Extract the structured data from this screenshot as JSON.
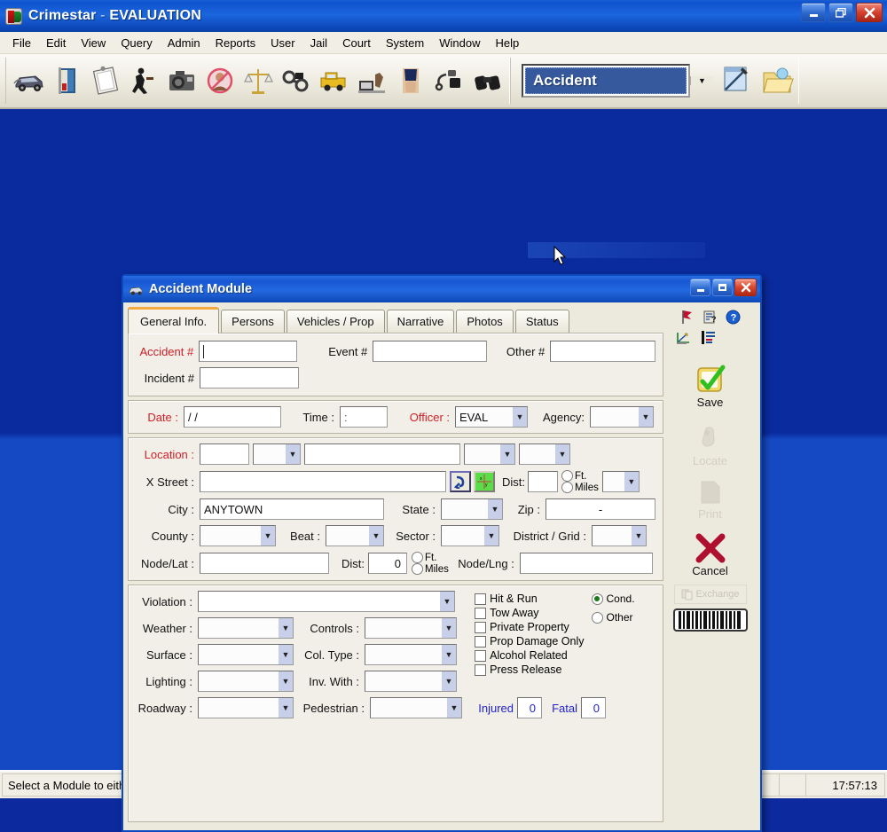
{
  "app": {
    "title_main": "Crimestar",
    "title_sep": " - ",
    "title_sub": "EVALUATION",
    "icon": "crimestar-logo-icon",
    "window_buttons": {
      "minimize": "minimize-icon",
      "restore": "restore-icon",
      "close": "close-icon"
    }
  },
  "menubar": {
    "items": [
      {
        "label": "File"
      },
      {
        "label": "Edit"
      },
      {
        "label": "View"
      },
      {
        "label": "Query"
      },
      {
        "label": "Admin"
      },
      {
        "label": "Reports"
      },
      {
        "label": "User"
      },
      {
        "label": "Jail"
      },
      {
        "label": "Court"
      },
      {
        "label": "System"
      },
      {
        "label": "Window"
      },
      {
        "label": "Help"
      }
    ]
  },
  "toolbar": {
    "buttons": [
      {
        "icon": "accident-car-icon"
      },
      {
        "icon": "field-contact-icon"
      },
      {
        "icon": "report-clipboard-icon"
      },
      {
        "icon": "arrest-person-icon"
      },
      {
        "icon": "evidence-camera-icon"
      },
      {
        "icon": "wanted-person-icon"
      },
      {
        "icon": "court-scales-icon"
      },
      {
        "icon": "handcuffs-icon"
      },
      {
        "icon": "vehicle-tow-icon"
      },
      {
        "icon": "property-icon"
      },
      {
        "icon": "booking-icon"
      },
      {
        "icon": "radio-device-icon"
      },
      {
        "icon": "binoculars-surveillance-icon"
      }
    ],
    "module_select": {
      "value": "Accident",
      "arrow": "chevron-down-icon"
    },
    "new_record_icon": "new-record-pen-icon",
    "open_record_icon": "open-folder-icon"
  },
  "module": {
    "title": "Accident Module",
    "icon": "accident-module-icon",
    "window_buttons": {
      "minimize": "minimize-icon",
      "maximize": "maximize-icon",
      "close": "close-icon"
    },
    "tabs": [
      {
        "label": "General Info.",
        "active": true
      },
      {
        "label": "Persons",
        "active": false
      },
      {
        "label": "Vehicles / Prop",
        "active": false
      },
      {
        "label": "Narrative",
        "active": false
      },
      {
        "label": "Photos",
        "active": false
      },
      {
        "label": "Status",
        "active": false
      }
    ],
    "tab_icons": [
      {
        "icon": "flag-marker-icon"
      },
      {
        "icon": "clipboard-help-icon"
      },
      {
        "icon": "help-question-icon"
      }
    ],
    "side_icons": [
      {
        "icon": "diagram-sketch-icon"
      },
      {
        "icon": "outline-list-icon"
      }
    ],
    "actions": [
      {
        "label": "Save",
        "icon": "save-check-icon",
        "disabled": false,
        "accesskey": "S"
      },
      {
        "label": "Locate",
        "icon": "locate-person-icon",
        "disabled": true
      },
      {
        "label": "Print",
        "icon": "print-page-icon",
        "disabled": true
      },
      {
        "label": "Cancel",
        "icon": "cancel-x-icon",
        "disabled": false
      }
    ],
    "exchange_button": {
      "label": "Exchange",
      "icon": "exchange-cards-icon",
      "disabled": true
    },
    "barcode": {
      "icon": "barcode-icon"
    }
  },
  "form": {
    "numbers_panel": {
      "accident_label": "Accident #",
      "accident_value": "",
      "event_label": "Event #",
      "event_value": "",
      "other_label": "Other #",
      "other_value": "",
      "incident_label": "Incident #",
      "incident_value": ""
    },
    "datetime_panel": {
      "date_label": "Date :",
      "date_value": "/  /",
      "time_label": "Time :",
      "time_value": ":",
      "officer_label": "Officer :",
      "officer_value": "EVAL",
      "agency_label": "Agency:",
      "agency_value": ""
    },
    "location_panel": {
      "location_label": "Location :",
      "location_num": "",
      "location_dir": "",
      "location_street": "",
      "location_type": "",
      "location_suffix": "",
      "xstreet_label": "X Street :",
      "xstreet_value": "",
      "xstreet_buttons": [
        {
          "icon": "street-swap-icon"
        },
        {
          "icon": "xy-coordinate-icon"
        }
      ],
      "dist_label": "Dist:",
      "dist_value": "",
      "unit_ft": "Ft.",
      "unit_miles": "Miles",
      "dir_value": "",
      "city_label": "City :",
      "city_value": "ANYTOWN",
      "state_label": "State :",
      "state_value": "",
      "zip_label": "Zip :",
      "zip_value": "-",
      "county_label": "County :",
      "county_value": "",
      "beat_label": "Beat :",
      "beat_value": "",
      "sector_label": "Sector :",
      "sector_value": "",
      "district_label": "District / Grid :",
      "district_value": "",
      "nodelat_label": "Node/Lat :",
      "nodelat_value": "",
      "node_dist_label": "Dist:",
      "node_dist_value": "0",
      "nodelng_label": "Node/Lng :",
      "nodelng_value": ""
    },
    "details_panel": {
      "violation_label": "Violation :",
      "violation_value": "",
      "weather_label": "Weather :",
      "weather_value": "",
      "controls_label": "Controls :",
      "controls_value": "",
      "surface_label": "Surface :",
      "surface_value": "",
      "coltype_label": "Col. Type :",
      "coltype_value": "",
      "lighting_label": "Lighting :",
      "lighting_value": "",
      "invwith_label": "Inv. With :",
      "invwith_value": "",
      "roadway_label": "Roadway :",
      "roadway_value": "",
      "pedestrian_label": "Pedestrian :",
      "pedestrian_value": "",
      "injured_label": "Injured",
      "injured_value": "0",
      "fatal_label": "Fatal",
      "fatal_value": "0",
      "checkboxes": [
        {
          "label": "Hit & Run",
          "checked": false
        },
        {
          "label": "Tow Away",
          "checked": false
        },
        {
          "label": "Private Property",
          "checked": false
        },
        {
          "label": "Prop Damage Only",
          "checked": false
        },
        {
          "label": "Alcohol Related",
          "checked": false
        },
        {
          "label": "Press Release",
          "checked": false
        }
      ],
      "radios": [
        {
          "label": "Cond.",
          "selected": true
        },
        {
          "label": "Other",
          "selected": false
        }
      ]
    }
  },
  "statusbar": {
    "message": "Select a Module to either create a NEW record or recall and OPEN an existing record",
    "time": "17:57:13"
  },
  "colors": {
    "titlebar_blue": "#1757d2",
    "desktop_blue": "#0a2b9e",
    "required_red": "#d02028",
    "tab_accent": "#f3a93c",
    "counter_blue": "#2222cc"
  }
}
